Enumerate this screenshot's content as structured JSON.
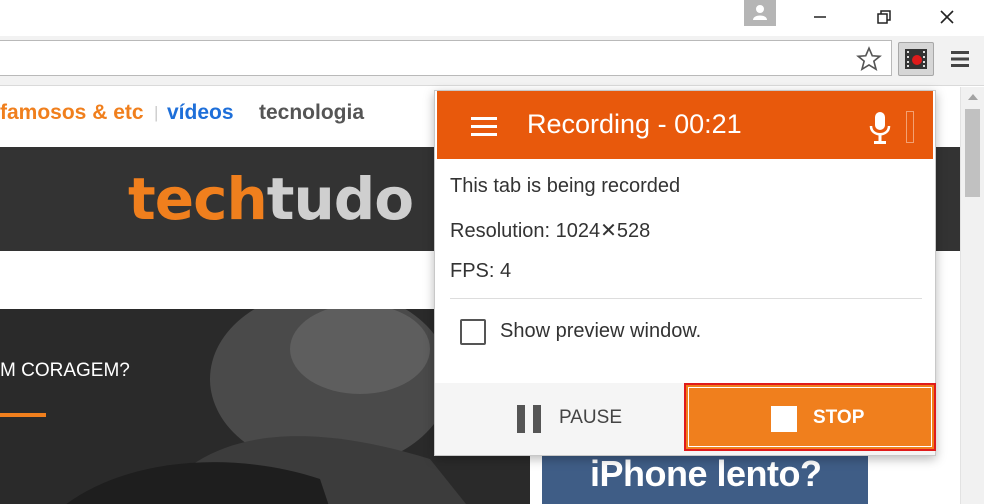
{
  "page": {
    "nav_links": [
      "famosos & etc",
      "vídeos",
      "tecnologia"
    ],
    "separator": "|",
    "logo_part1": "tech",
    "logo_part2": "tudo",
    "hero_text": "M CORAGEM?",
    "promo_text": "iPhone lento?"
  },
  "popup": {
    "title": "Recording - 00:21",
    "status_text": "This tab is being recorded",
    "resolution_text": "Resolution: 1024✕528",
    "fps_text": "FPS: 4",
    "preview_checkbox_label": "Show preview window.",
    "preview_checked": false,
    "pause_label": "PAUSE",
    "stop_label": "STOP"
  },
  "icons": {
    "user": "user-icon",
    "minimize": "minimize-icon",
    "restore": "restore-icon",
    "close": "close-icon",
    "bookmark": "star-icon",
    "extension": "screen-recorder-icon",
    "browser_menu": "hamburger-icon",
    "popup_menu": "hamburger-icon",
    "microphone": "microphone-icon",
    "pause": "pause-icon",
    "stop": "stop-icon"
  },
  "colors": {
    "popup_header": "#e8590c",
    "stop_button": "#f07f1d",
    "stop_highlight_border": "#e01b1b",
    "brand_orange": "#f07f1d",
    "link_blue": "#1e6fd9"
  }
}
